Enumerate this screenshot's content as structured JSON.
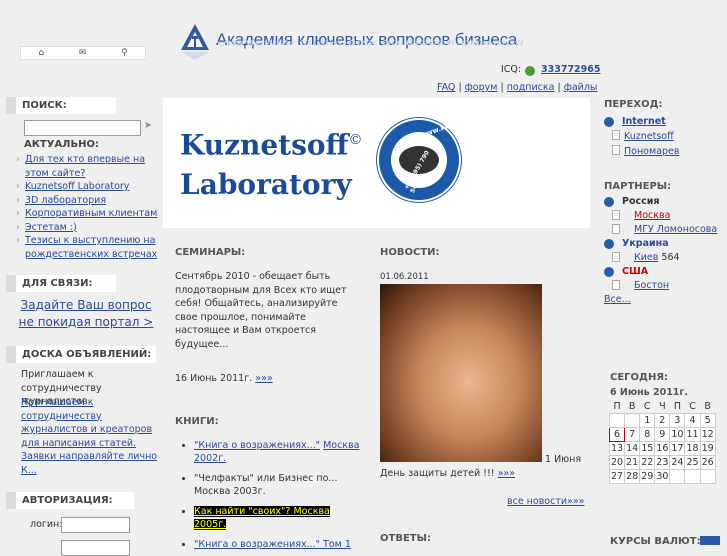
{
  "header": {
    "title": "Академия ключевых вопросов бизнеса",
    "icq_label": "ICQ:",
    "icq_number": "333772965",
    "links": [
      "FAQ",
      "форум",
      "подписка",
      "файлы"
    ],
    "separator": "|"
  },
  "top_icons": [
    "home-icon",
    "mail-icon",
    "search-icon"
  ],
  "left": {
    "search_title": "ПОИСК:",
    "search_button": "➤",
    "actual_title": "АКТУАЛЬНО:",
    "actual_items": [
      "Для тех кто впервые на этом сайте?",
      "Kuznetsoff Laboratory",
      "3D лаборатория",
      "Корпоративным клиентам",
      "Эстетам :)",
      "Тезисы к выступлению на рождественских встречах"
    ],
    "contact_title": "ДЛЯ СВЯЗИ:",
    "contact_link": "Задайте Ваш вопрос не покидая портал >",
    "board_title": "ДОСКА ОБЪЯВЛЕНИЙ:",
    "board_text": "Приглашаем к сотрудничеству журналистов",
    "board_link": "Приглашаем к сотрудничеству журналистов и креаторов для написания статей. Заявки направляйте лично К...",
    "auth_title": "АВТОРИЗАЦИЯ:",
    "login_label": "логин:"
  },
  "banner": {
    "line1": "Kuznetsoff",
    "copyright": "©",
    "line2": "Laboratory",
    "site": "www.ku3.ru",
    "phone": "+7 (495) 790 5415"
  },
  "seminars": {
    "title": "СЕМИНАРЫ:",
    "text": "Сентябрь 2010 - обещает быть плодотворным для Всех кто ищет себя! Общайтесь, анализируйте свое прошлое, понимайте настоящее и Вам откроется будущее...",
    "date": "16 Июнь 2011г.",
    "more": "»»»"
  },
  "books": {
    "title": "КНИГИ:",
    "items": [
      {
        "link": "\"Книга о возражениях...\"",
        "rest": "Москва 2002г."
      },
      {
        "text": "\"Челфакты\" или Бизнес по... Москва 2003г."
      },
      {
        "highlight": "Как найти \"своих\"? Москва 2005г."
      },
      {
        "link": "\"Книга о возражениях...\" Том 1"
      }
    ]
  },
  "news": {
    "title": "НОВОСТИ:",
    "date": "01.06.2011",
    "photo_date": "1 Июня",
    "caption": "День защиты детей !!!",
    "more": "»»»",
    "all": "все новости»»»"
  },
  "answers": {
    "title": "ОТВЕТЫ:"
  },
  "right": {
    "goto_title": "ПЕРЕХОД:",
    "goto_head": "Internet",
    "goto_items": [
      "Kuznetsoff",
      "Пономарев"
    ],
    "partners_title": "ПАРТНЕРЫ:",
    "groups": [
      {
        "country": "Россия",
        "items": [
          "Москва",
          "МГУ Ломоносова"
        ]
      },
      {
        "country": "Украина",
        "items": [
          "Киев"
        ],
        "count": "564"
      },
      {
        "country": "США",
        "items": [
          "Бостон"
        ]
      }
    ],
    "all": "Все...",
    "today_title": "СЕГОДНЯ:",
    "today_date": "6 Июнь 2011г.",
    "weekdays": [
      "П",
      "В",
      "С",
      "Ч",
      "П",
      "С",
      "В"
    ],
    "weeks": [
      [
        "",
        "",
        "1",
        "2",
        "3",
        "4",
        "5"
      ],
      [
        "6",
        "7",
        "8",
        "9",
        "10",
        "11",
        "12"
      ],
      [
        "13",
        "14",
        "15",
        "16",
        "17",
        "18",
        "19"
      ],
      [
        "20",
        "21",
        "22",
        "23",
        "24",
        "25",
        "26"
      ],
      [
        "27",
        "28",
        "29",
        "30",
        "",
        "",
        ""
      ]
    ],
    "rates_title": "КУРСЫ ВАЛЮТ:"
  },
  "colors": {
    "link": "#2a4a9a",
    "brand": "#1a4a9a",
    "highlight_bg": "#000000",
    "highlight_fg": "#ffff00",
    "red": "#cc0000"
  }
}
